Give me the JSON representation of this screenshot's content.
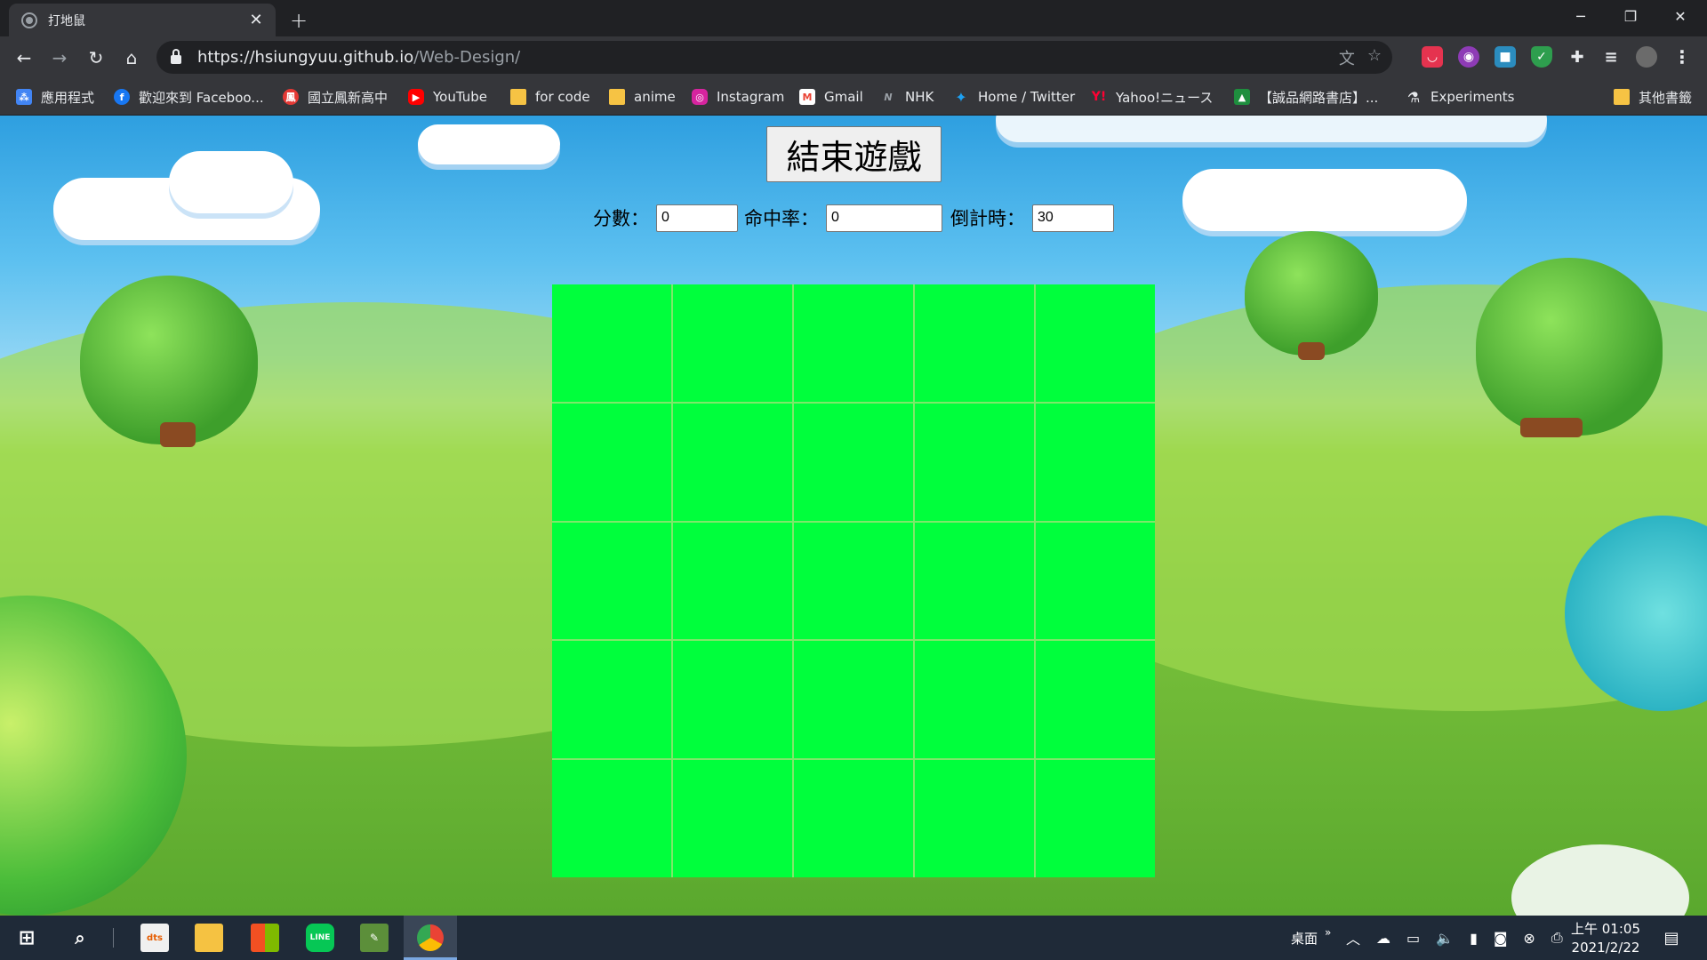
{
  "browser": {
    "tab_title": "打地鼠",
    "tab_close": "✕",
    "new_tab": "+",
    "url_host": "https://hsiungyuu.github.io",
    "url_path": "/Web-Design/",
    "window_controls": [
      "─",
      "❐",
      "✕"
    ]
  },
  "bookmarks": [
    {
      "label": "應用程式",
      "icon": "apps-grid-icon",
      "color": "#4285f4"
    },
    {
      "label": "歡迎來到 Faceboo...",
      "icon": "facebook-icon",
      "color": "#1877f2"
    },
    {
      "label": "國立鳳新高中",
      "icon": "school-icon",
      "color": "#e53935"
    },
    {
      "label": "YouTube",
      "icon": "youtube-icon",
      "color": "#ff0000"
    },
    {
      "label": "for code",
      "icon": "folder-icon",
      "color": "#f6c344"
    },
    {
      "label": "anime",
      "icon": "folder-icon",
      "color": "#f6c344"
    },
    {
      "label": "Instagram",
      "icon": "instagram-icon",
      "color": "#d6249f"
    },
    {
      "label": "Gmail",
      "icon": "gmail-icon",
      "color": "#ea4335"
    },
    {
      "label": "NHK",
      "icon": "nhk-icon",
      "color": "#777777"
    },
    {
      "label": "Home / Twitter",
      "icon": "twitter-icon",
      "color": "#1da1f2"
    },
    {
      "label": "Yahoo!ニュース",
      "icon": "yahoo-icon",
      "color": "#ff0033"
    },
    {
      "label": "【誠品網路書店】...",
      "icon": "bookstore-icon",
      "color": "#1e8e3e"
    },
    {
      "label": "Experiments",
      "icon": "flask-icon",
      "color": "#e8eaed"
    },
    {
      "label": "其他書籤",
      "icon": "folder-icon",
      "color": "#f6c344"
    }
  ],
  "game": {
    "end_button": "結束遊戲",
    "score_label": "分數：",
    "score_value": "0",
    "hit_rate_label": "命中率：",
    "hit_rate_value": "0",
    "countdown_label": "倒計時：",
    "countdown_value": "30",
    "grid_rows": 5,
    "grid_cols": 5,
    "cell_color": "#00ff3c"
  },
  "taskbar": {
    "desktop_label": "桌面",
    "time": "上午 01:05",
    "date": "2021/2/22"
  }
}
